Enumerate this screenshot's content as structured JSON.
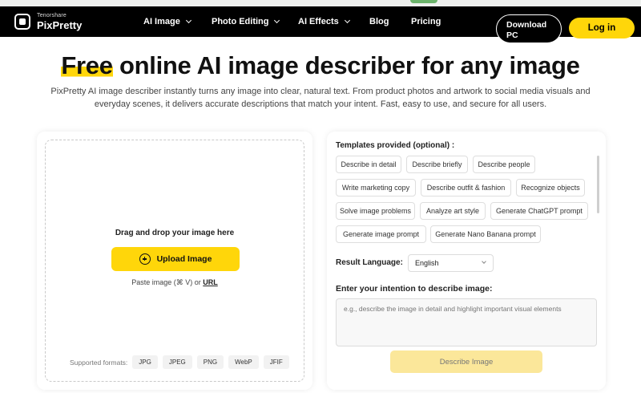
{
  "brand": {
    "small": "Tenorshare",
    "name": "PixPretty"
  },
  "nav": {
    "items": [
      {
        "label": "AI Image",
        "dropdown": true
      },
      {
        "label": "Photo Editing",
        "dropdown": true
      },
      {
        "label": "AI Effects",
        "dropdown": true
      },
      {
        "label": "Blog",
        "dropdown": false
      },
      {
        "label": "Pricing",
        "dropdown": false
      }
    ],
    "download_line1": "Download",
    "download_line2": "PC",
    "login": "Log in"
  },
  "hero": {
    "title_highlight": "Free",
    "title_rest": " online AI image describer for any image",
    "subtitle": "PixPretty AI image describer instantly turns any image into clear, natural text. From product photos and artwork to social media visuals and everyday scenes, it delivers accurate descriptions that match your intent. Fast, easy to use, and secure for all users."
  },
  "upload": {
    "drag_text": "Drag and drop your image here",
    "button": "Upload Image",
    "paste_prefix": "Paste image (⌘ V) or ",
    "url_link": "URL",
    "formats_label": "Supported formats:",
    "formats": [
      "JPG",
      "JPEG",
      "PNG",
      "WebP",
      "JFIF"
    ]
  },
  "describer": {
    "templates_label": "Templates provided (optional) :",
    "templates": [
      "Describe in detail",
      "Describe briefly",
      "Describe people",
      "Write marketing copy",
      "Describe outfit & fashion",
      "Recognize objects",
      "Solve image problems",
      "Analyze art style",
      "Generate ChatGPT prompt",
      "Generate image prompt",
      "Generate Nano Banana prompt"
    ],
    "language_label": "Result Language:",
    "language_value": "English",
    "intent_label": "Enter your intention to describe image:",
    "intent_placeholder": "e.g., describe the image in detail and highlight important visual elements",
    "submit": "Describe Image"
  },
  "colors": {
    "accent": "#ffd60a",
    "nav_bg": "#000000",
    "button_disabled": "#fbe79a"
  }
}
